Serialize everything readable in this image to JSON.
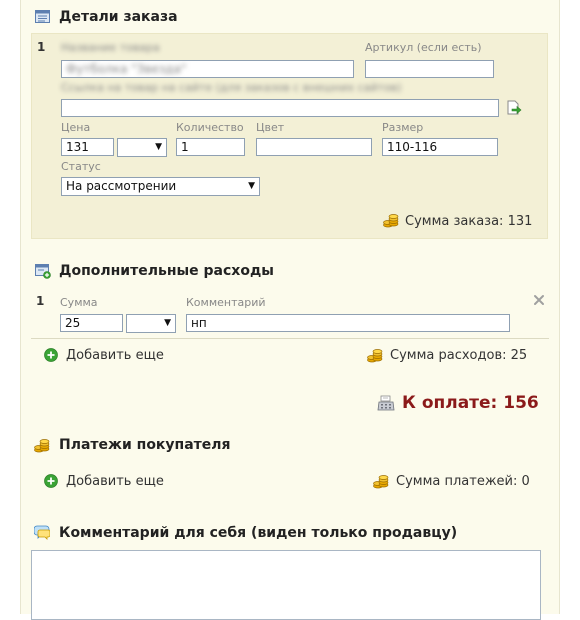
{
  "order_details": {
    "title": "Детали заказа",
    "item_number": "1",
    "product_name_label": "Название товара",
    "product_name_value": "Футболка \"Звезда\"",
    "sku_label": "Артикул (если есть)",
    "sku_value": "",
    "link_label": "Ссылка на товар на сайте (для заказов с внешних сайтов)",
    "link_value": "",
    "price_label": "Цена",
    "price_value": "131",
    "currency_value": "",
    "qty_label": "Количество",
    "qty_value": "1",
    "color_label": "Цвет",
    "color_value": "",
    "size_label": "Размер",
    "size_value": "110-116",
    "status_label": "Статус",
    "status_value": "На рассмотрении",
    "sum_text": "Сумма заказа: 131"
  },
  "extra_costs": {
    "title": "Дополнительные расходы",
    "item_number": "1",
    "sum_label": "Сумма",
    "sum_value": "25",
    "currency_value": "",
    "comment_label": "Комментарий",
    "comment_value": "нп",
    "add_more": "Добавить еще",
    "sum_text": "Сумма расходов: 25"
  },
  "total": {
    "text": "К оплате: 156",
    "color": "#8b1a1a"
  },
  "payments": {
    "title": "Платежи покупателя",
    "add_more": "Добавить еще",
    "sum_text": "Сумма платежей: 0"
  },
  "comment": {
    "title": "Комментарий для себя (виден только продавцу)",
    "value": ""
  }
}
